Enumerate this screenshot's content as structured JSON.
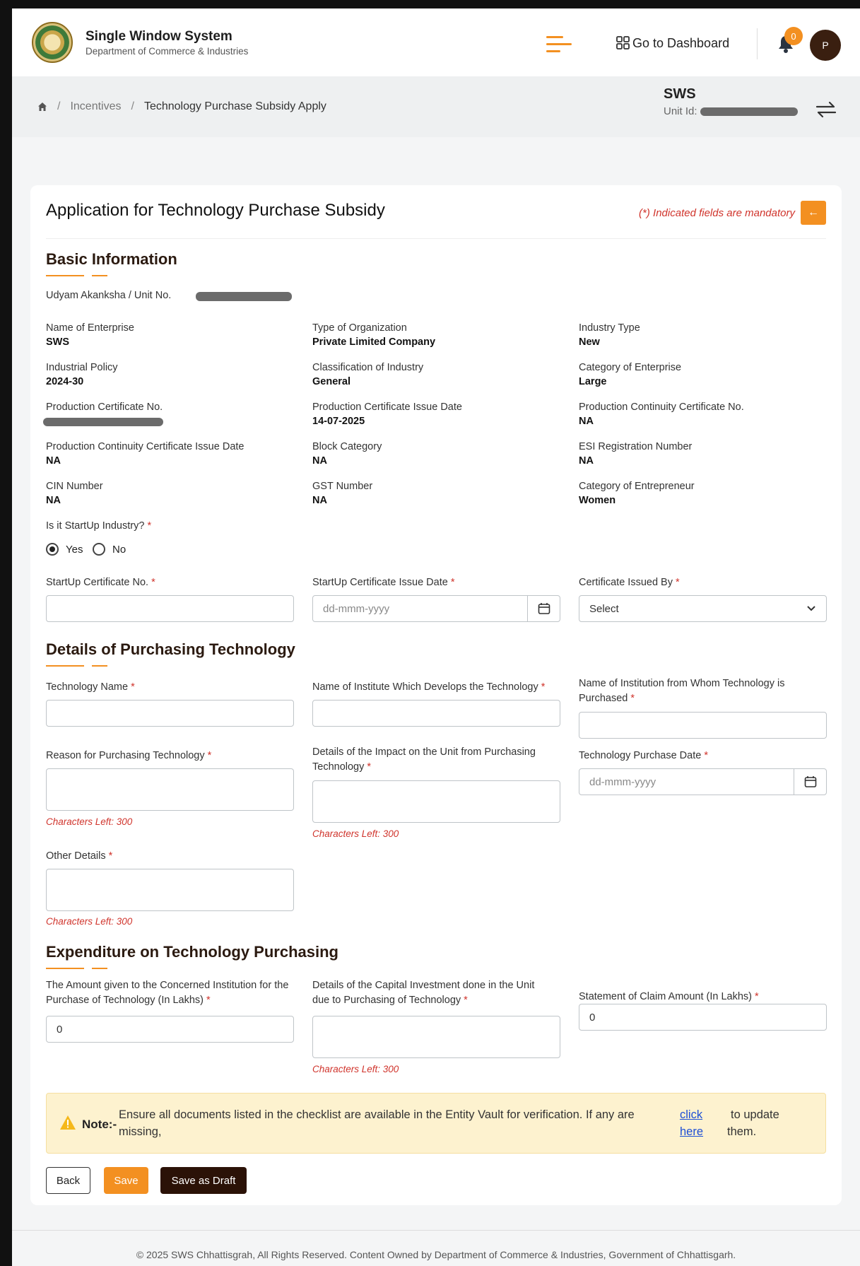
{
  "header": {
    "title": "Single Window System",
    "subtitle": "Department of Commerce & Industries",
    "dashboard_label": "Go to Dashboard",
    "notification_count": "0",
    "avatar_initial": "P"
  },
  "breadcrumb": {
    "items": [
      "Incentives",
      "Technology Purchase Subsidy Apply"
    ],
    "separator": "/"
  },
  "unit": {
    "name": "SWS",
    "id_label": "Unit Id:"
  },
  "form": {
    "title": "Application for Technology Purchase Subsidy",
    "mandatory_note": "(*) Indicated fields are mandatory",
    "back_arrow": "←",
    "required_mark": "*",
    "basic": {
      "title": "Basic Information",
      "udyam_label": "Udyam Akanksha / Unit No.",
      "fields": [
        {
          "label": "Name of Enterprise",
          "value": "SWS"
        },
        {
          "label": "Type of Organization",
          "value": "Private Limited Company"
        },
        {
          "label": "Industry Type",
          "value": "New"
        },
        {
          "label": "Industrial Policy",
          "value": "2024-30"
        },
        {
          "label": "Classification of Industry",
          "value": "General"
        },
        {
          "label": "Category of Enterprise",
          "value": "Large"
        },
        {
          "label": "Production Certificate No.",
          "value": ""
        },
        {
          "label": "Production Certificate Issue Date",
          "value": "14-07-2025"
        },
        {
          "label": "Production Continuity Certificate No.",
          "value": "NA"
        },
        {
          "label": "Production Continuity Certificate Issue Date",
          "value": "NA"
        },
        {
          "label": "Block Category",
          "value": "NA"
        },
        {
          "label": "ESI Registration Number",
          "value": "NA"
        },
        {
          "label": "CIN Number",
          "value": "NA"
        },
        {
          "label": "GST Number",
          "value": "NA"
        },
        {
          "label": "Category of Entrepreneur",
          "value": "Women"
        }
      ],
      "startup_question": "Is it StartUp Industry?",
      "startup_yes": "Yes",
      "startup_no": "No",
      "startup_selected": "Yes",
      "startup_cert_label": "StartUp Certificate No.",
      "startup_date_label": "StartUp Certificate Issue Date",
      "date_placeholder": "dd-mmm-yyyy",
      "issued_by_label": "Certificate Issued By",
      "issued_by_value": "Select"
    },
    "tech": {
      "title": "Details of Purchasing Technology",
      "tech_name_label": "Technology Name",
      "institute_label": "Name of Institute Which Develops the Technology",
      "institution_label": "Name of Institution from Whom Technology is Purchased",
      "reason_label": "Reason for Purchasing Technology",
      "impact_label": "Details of the Impact on the Unit from Purchasing Technology",
      "purchase_date_label": "Technology Purchase Date",
      "date_placeholder": "dd-mmm-yyyy",
      "other_label": "Other Details",
      "chars_left": "Characters Left: 300"
    },
    "expenditure": {
      "title": "Expenditure on Technology Purchasing",
      "amount_label": "The Amount given to the Concerned Institution for the Purchase of Technology (In Lakhs)",
      "amount_value": "0",
      "capital_label": "Details of the Capital Investment done in the Unit due to Purchasing of Technology",
      "claim_label": "Statement of Claim Amount (In Lakhs)",
      "claim_value": "0",
      "chars_left": "Characters Left: 300"
    },
    "note": {
      "label": "Note:-",
      "text_line1": "Ensure all documents listed in the checklist are available in the Entity Vault for verification. If any are",
      "text_line2": "missing,",
      "link_line1": "click",
      "link_line2": "here",
      "tail_line1": "to update",
      "tail_line2": "them."
    },
    "buttons": {
      "back": "Back",
      "save": "Save",
      "draft": "Save as Draft"
    }
  },
  "footer": {
    "text": "© 2025 SWS Chhattisgrah, All Rights Reserved. Content Owned by Department of Commerce & Industries, Government of Chhattisgarh."
  }
}
